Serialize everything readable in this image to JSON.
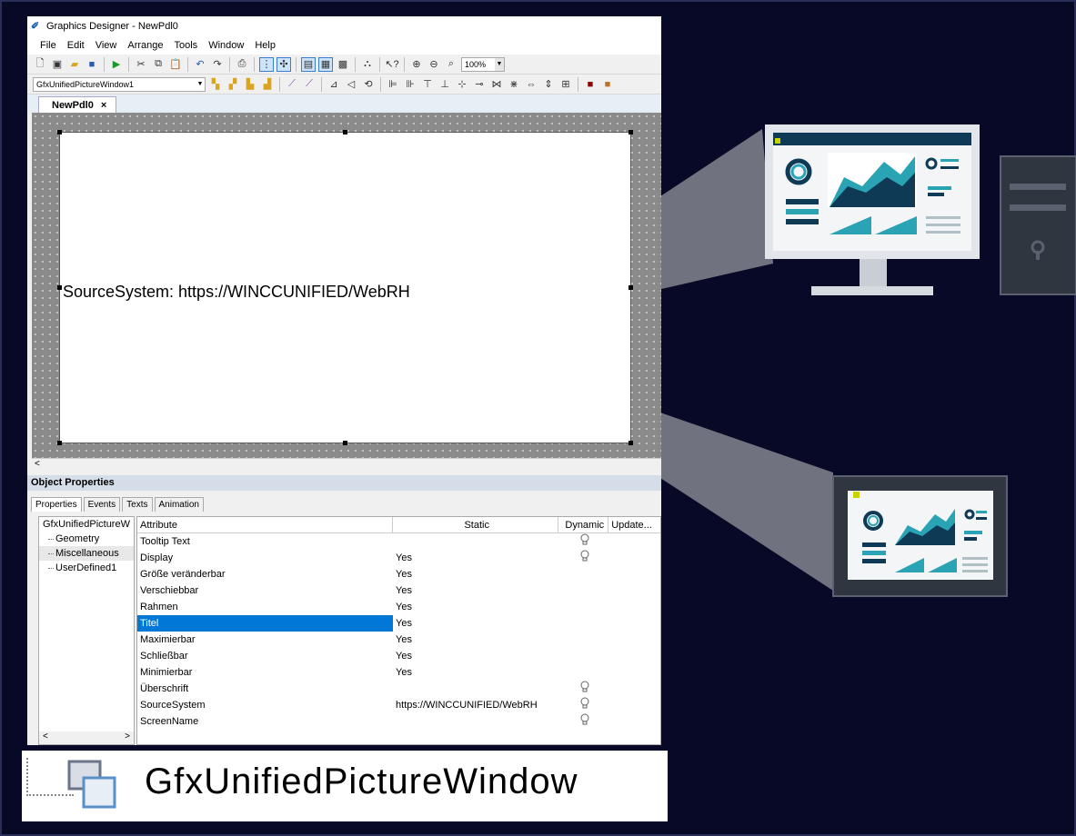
{
  "window": {
    "title": "Graphics Designer - NewPdl0",
    "menu": [
      "File",
      "Edit",
      "View",
      "Arrange",
      "Tools",
      "Window",
      "Help"
    ],
    "zoom": "100%",
    "object_selector": "GfxUnifiedPictureWindow1",
    "doc_tab": "NewPdl0",
    "doc_tab_close": "×"
  },
  "canvas": {
    "picture_text": "SourceSystem: https://WINCCUNIFIED/WebRH",
    "scroll_left": "<"
  },
  "properties": {
    "panel_title": "Object Properties",
    "tabs": [
      "Properties",
      "Events",
      "Texts",
      "Animation"
    ],
    "active_tab": "Properties",
    "tree": {
      "root": "GfxUnifiedPictureW",
      "children": [
        "Geometry",
        "Miscellaneous",
        "UserDefined1"
      ],
      "scroll_left": "<",
      "scroll_right": ">"
    },
    "columns": [
      "Attribute",
      "Static",
      "Dynamic",
      "Update..."
    ],
    "rows": [
      {
        "attribute": "Tooltip Text",
        "static": "",
        "dynamic": "bulb"
      },
      {
        "attribute": "Display",
        "static": "Yes",
        "dynamic": "bulb"
      },
      {
        "attribute": "Größe veränderbar",
        "static": "Yes",
        "dynamic": ""
      },
      {
        "attribute": "Verschiebbar",
        "static": "Yes",
        "dynamic": ""
      },
      {
        "attribute": "Rahmen",
        "static": "Yes",
        "dynamic": ""
      },
      {
        "attribute": "Titel",
        "static": "Yes",
        "dynamic": "",
        "selected": true
      },
      {
        "attribute": "Maximierbar",
        "static": "Yes",
        "dynamic": ""
      },
      {
        "attribute": "Schließbar",
        "static": "Yes",
        "dynamic": ""
      },
      {
        "attribute": "Minimierbar",
        "static": "Yes",
        "dynamic": ""
      },
      {
        "attribute": "Überschrift",
        "static": "",
        "dynamic": "bulb"
      },
      {
        "attribute": "SourceSystem",
        "static": "https://WINCCUNIFIED/WebRH",
        "dynamic": "bulb"
      },
      {
        "attribute": "ScreenName",
        "static": "",
        "dynamic": "bulb"
      }
    ]
  },
  "label": {
    "text": "GfxUnifiedPictureWindow"
  },
  "colors": {
    "background": "#070926",
    "selection": "#0078d7",
    "monitor_frame": "#e2e6ea",
    "dashboard_teal": "#2aa4b5",
    "dashboard_navy": "#0e3a55",
    "panel_dark": "#2f3640"
  }
}
